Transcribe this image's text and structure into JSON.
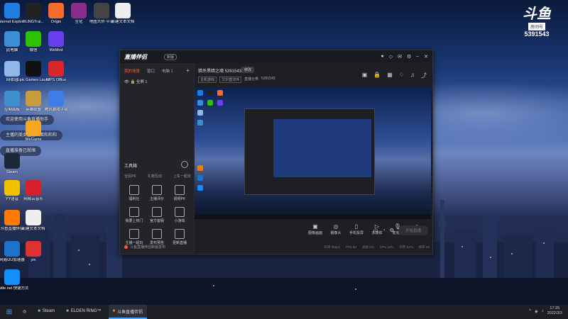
{
  "desktop": {
    "icons_col1": [
      {
        "label": "Internet Explorer",
        "icon": "ie-icon",
        "color": "#1f7ee0"
      },
      {
        "label": "此电脑",
        "icon": "computer-icon",
        "color": "#3b8fd6"
      },
      {
        "label": "回收站",
        "icon": "recycle-bin-icon",
        "color": "#8fb8e8"
      },
      {
        "label": "控制面板",
        "icon": "control-panel-icon",
        "color": "#3f8fcf"
      },
      {
        "label": "Steam",
        "icon": "steam-icon",
        "color": "#1b2838"
      },
      {
        "label": "YY语音",
        "icon": "yy-icon",
        "color": "#f2c100"
      },
      {
        "label": "斗鱼直播伴侣",
        "icon": "douyu-icon",
        "color": "#ff7b00"
      },
      {
        "label": "网易UU加速器",
        "icon": "uu-icon",
        "color": "#1d73c9"
      },
      {
        "label": "Battle.net 快捷方式",
        "icon": "battlenet-icon",
        "color": "#148eff"
      }
    ],
    "icons_col2": [
      {
        "label": "FLiNGTrai...",
        "icon": "fling-icon",
        "color": "#222"
      },
      {
        "label": "微信",
        "icon": "wechat-icon",
        "color": "#2dc100"
      },
      {
        "label": "Epic Games Launcher",
        "icon": "epic-icon",
        "color": "#111"
      },
      {
        "label": "英雄联盟",
        "icon": "lol-icon",
        "color": "#c89b3c"
      },
      {
        "label": "WeGame",
        "icon": "wegame-icon",
        "color": "#f5a623"
      },
      {
        "label": "网易云音乐",
        "icon": "netease-music-icon",
        "color": "#d9202a"
      },
      {
        "label": "新建文本文档",
        "icon": "text-file-icon",
        "color": "#eee"
      },
      {
        "label": "yin",
        "icon": "folder-red-icon",
        "color": "#d33"
      }
    ],
    "icons_col3": [
      {
        "label": "Origin",
        "icon": "origin-icon",
        "color": "#f56c2d"
      },
      {
        "label": "WeMod",
        "icon": "wemod-icon",
        "color": "#6b3ef0"
      },
      {
        "label": "WPS Office",
        "icon": "wps-icon",
        "color": "#d8262c"
      },
      {
        "label": "腾讯游戏平台",
        "icon": "tencent-game-icon",
        "color": "#3c7ee6"
      }
    ],
    "icons_top": [
      {
        "label": "生化",
        "icon": "winrar-icon",
        "color": "#8b2d8b"
      },
      {
        "label": "地图大师 平台",
        "icon": "map-game-icon",
        "color": "#444"
      },
      {
        "label": "新建文本文档",
        "icon": "text-file-icon",
        "color": "#eee"
      }
    ],
    "notifications": [
      "欢迎使用斗鱼直播助手",
      "主播的美女主播画面和和和",
      "直播准备已就绪"
    ],
    "brand": {
      "logo": "斗鱼",
      "room_label": "房间号",
      "room_number": "5391543"
    }
  },
  "app": {
    "logo": "直播伴侣",
    "version_badge": "新版",
    "tabs": [
      "我的场景",
      "窗口",
      "电脑 1"
    ],
    "scene_item": "全屏 1",
    "toolbox_title": "工具箱",
    "modes": [
      "全民PK",
      "礼物互动",
      "上车一起玩"
    ],
    "tools": [
      {
        "label": "福利社",
        "icon": "bike-icon"
      },
      {
        "label": "主播评价",
        "icon": "diy-icon"
      },
      {
        "label": "视频PK",
        "icon": "home-icon"
      },
      {
        "label": "我要上热门",
        "icon": "camera-icon"
      },
      {
        "label": "官方客服",
        "icon": "scissors-icon"
      },
      {
        "label": "小游戏",
        "icon": "gamepad-icon"
      },
      {
        "label": "主播一起玩",
        "icon": "gift-icon"
      },
      {
        "label": "发布预告",
        "icon": "cube-icon"
      },
      {
        "label": "更新直播",
        "icon": "download-icon"
      }
    ],
    "left_footer": "斗鱼直播伴侣新版发布",
    "room_title": "猎杀黑暗之魂 5391543",
    "room_button": "修改",
    "tags": [
      "主机游戏",
      "艾尔登法环",
      "直播分类",
      "5391543"
    ],
    "bottom_tools": [
      {
        "label": "图像画面",
        "icon": "image-icon"
      },
      {
        "label": "摄像头",
        "icon": "webcam-icon"
      },
      {
        "label": "手机投屏",
        "icon": "phone-icon"
      },
      {
        "label": "多媒体",
        "icon": "media-icon"
      },
      {
        "label": "麦克风",
        "icon": "mic-icon"
      },
      {
        "label": "扬声器",
        "icon": "speaker-icon"
      }
    ],
    "go_live": "开始直播",
    "status_items": [
      "码率 0kbps",
      "FPS 60",
      "丢帧 0%",
      "CPU 10%",
      "内存 52%",
      "帧率 60"
    ]
  },
  "taskbar": {
    "apps": [
      {
        "label": "Steam",
        "icon": "steam-icon",
        "active": false
      },
      {
        "label": "ELDEN RING™",
        "icon": "elden-ring-icon",
        "active": false
      },
      {
        "label": "斗鱼直播伴侣",
        "icon": "douyu-icon",
        "active": true
      }
    ],
    "time": "17:25",
    "date": "2022/3/3"
  },
  "colors": {
    "accent": "#ff5a3c",
    "taskbar": "#1c1e24",
    "app_bg": "#1e1f24"
  }
}
